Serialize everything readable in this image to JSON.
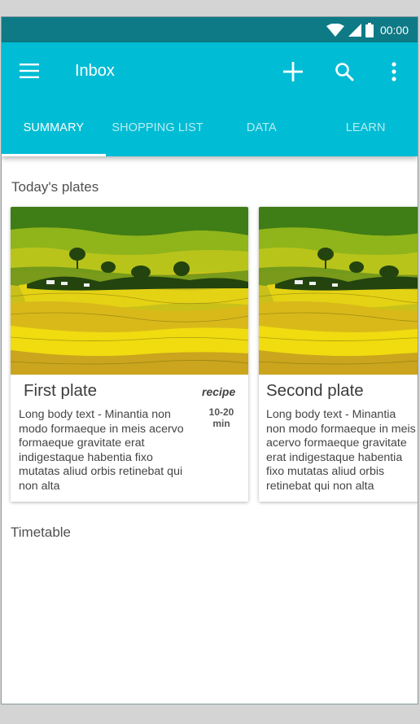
{
  "status_bar": {
    "time": "00:00",
    "icons": [
      "wifi-icon",
      "signal-icon",
      "battery-icon"
    ]
  },
  "app_bar": {
    "title": "Inbox",
    "icons": [
      "menu-icon",
      "add-icon",
      "search-icon",
      "more-vert-icon"
    ],
    "tabs": [
      {
        "label": "SUMMARY",
        "active": true
      },
      {
        "label": "SHOPPING LIST",
        "active": false
      },
      {
        "label": "DATA",
        "active": false
      },
      {
        "label": "LEARN",
        "active": false
      }
    ]
  },
  "main": {
    "section_title": "Today's plates",
    "cards": [
      {
        "title": "First plate",
        "tag": "recipe",
        "time_line1": "10-20",
        "time_line2": "min",
        "body": "Long body text - Minantia non modo formaeque in meis acervo formaeque gravitate erat indigestaque habentia fixo mutatas aliud orbis retinebat qui non alta"
      },
      {
        "title": "Second plate",
        "body": "Long body text - Minantia non modo formaeque in meis acervo formaeque gravitate erat indigestaque habentia fixo mutatas aliud orbis retinebat qui non alta"
      }
    ],
    "timetable_title": "Timetable"
  },
  "colors": {
    "primary": "#00bcd4",
    "status_bar": "#0e7a86",
    "text": "#444444",
    "background": "#ffffff"
  }
}
